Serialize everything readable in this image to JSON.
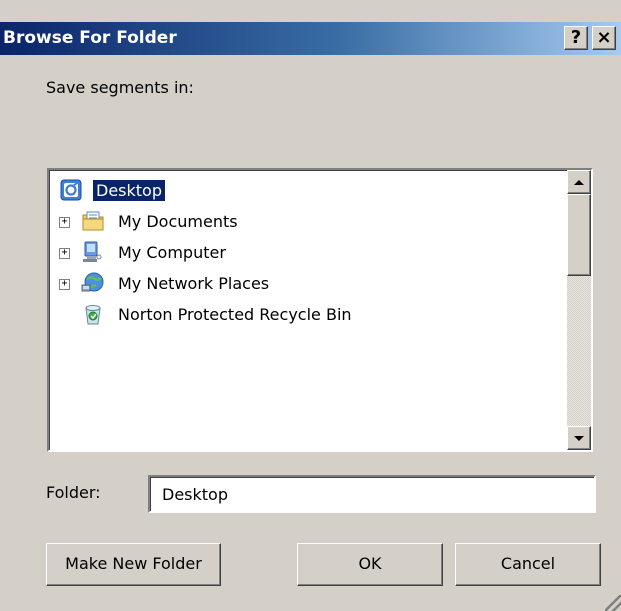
{
  "window": {
    "title": "Browse For Folder",
    "help_label": "?",
    "close_label": "×"
  },
  "prompt": "Save segments in:",
  "tree": {
    "items": [
      {
        "label": "Desktop",
        "icon": "desktop-icon",
        "selected": true,
        "expandable": false
      },
      {
        "label": "My Documents",
        "icon": "my-documents-icon",
        "selected": false,
        "expandable": true
      },
      {
        "label": "My Computer",
        "icon": "my-computer-icon",
        "selected": false,
        "expandable": true
      },
      {
        "label": "My Network Places",
        "icon": "network-places-icon",
        "selected": false,
        "expandable": true
      },
      {
        "label": "Norton Protected Recycle Bin",
        "icon": "recycle-bin-icon",
        "selected": false,
        "expandable": false
      }
    ],
    "expand_glyph": "+"
  },
  "folder": {
    "label": "Folder:",
    "value": "Desktop"
  },
  "buttons": {
    "new_folder": "Make New Folder",
    "ok": "OK",
    "cancel": "Cancel"
  },
  "colors": {
    "dialog_bg": "#d4d0c8",
    "selection": "#0a246a",
    "titlebar_start": "#0a246a",
    "titlebar_end": "#a6caf0"
  }
}
